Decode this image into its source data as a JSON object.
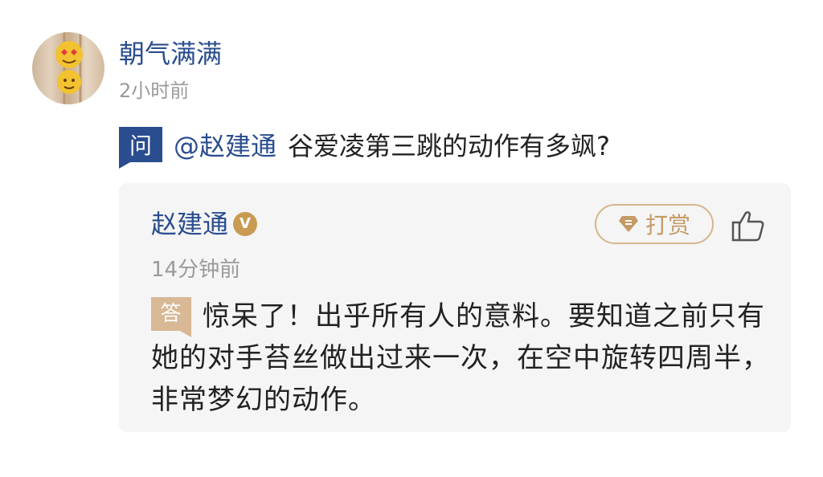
{
  "comment": {
    "username": "朝气满满",
    "time": "2小时前",
    "question_badge": "问",
    "mention": "@赵建通",
    "question_text": "谷爱凌第三跳的动作有多飒?"
  },
  "answer": {
    "author": "赵建通",
    "verified_badge": "V",
    "tip_label": "打赏",
    "time": "14分钟前",
    "answer_badge": "答",
    "text": "惊呆了！出乎所有人的意料。要知道之前只有她的对手苔丝做出过来一次，在空中旋转四周半，非常梦幻的动作。"
  },
  "colors": {
    "link_blue": "#2a4d8f",
    "gold": "#c99a52",
    "gray_text": "#9a9a9a",
    "panel_bg": "#f5f5f5"
  },
  "icons": [
    "avatar",
    "verified-icon",
    "gem-icon",
    "thumbs-up-icon"
  ]
}
